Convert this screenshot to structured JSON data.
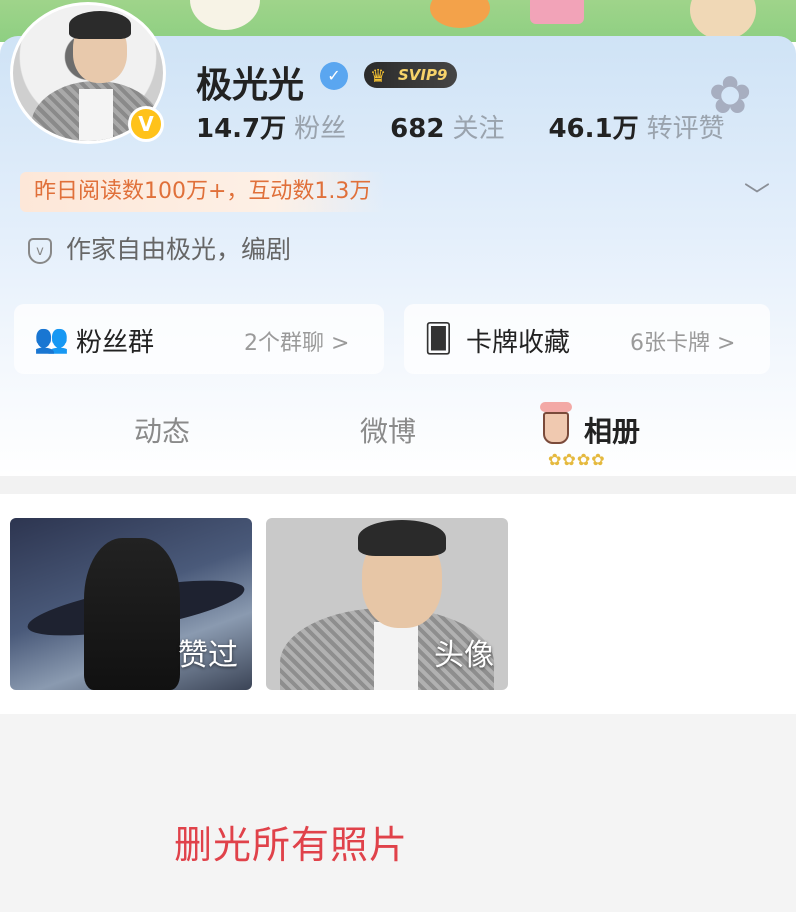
{
  "profile": {
    "name": "极光光",
    "vip_label": "SVIP9",
    "verified_badge": "V",
    "stats": [
      {
        "value": "14.7万",
        "label": "粉丝"
      },
      {
        "value": "682",
        "label": "关注"
      },
      {
        "value": "46.1万",
        "label": "转评赞"
      }
    ],
    "highlight": "昨日阅读数100万+，互动数1.3万",
    "bio": "作家自由极光，编剧"
  },
  "cards": [
    {
      "title": "粉丝群",
      "sub": "2个群聊 >"
    },
    {
      "title": "卡牌收藏",
      "sub": "6张卡牌 >"
    }
  ],
  "tabs": [
    {
      "label": "动态"
    },
    {
      "label": "微博"
    },
    {
      "label": "相册"
    }
  ],
  "photos": [
    {
      "caption": "赞过"
    },
    {
      "caption": "头像"
    }
  ],
  "overlay_caption": "删光所有照片",
  "colors": {
    "accent_orange": "#e0703a",
    "caption_red": "#e0424a",
    "vip_gold": "#f7d36a",
    "verified_blue": "#5aa6f0",
    "avatar_badge": "#ffc21a"
  },
  "icons": [
    "verified-icon",
    "crown-icon",
    "flower-icon",
    "chevron-down-icon",
    "shield-icon",
    "fans-group-icon",
    "card-icon",
    "bubble-tea-icon",
    "stars-icon"
  ]
}
